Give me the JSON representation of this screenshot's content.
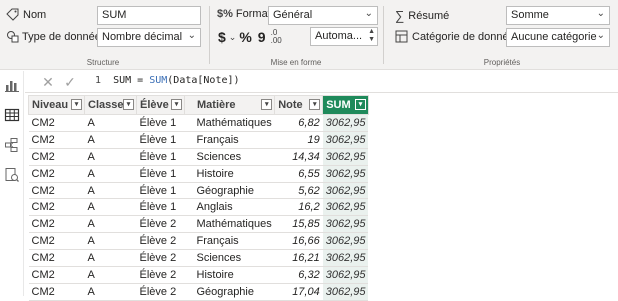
{
  "structure": {
    "name_label": "Nom",
    "name_value": "SUM",
    "datatype_label": "Type de données",
    "datatype_value": "Nombre décimal",
    "group_label": "Structure"
  },
  "formatting": {
    "format_label": "Format",
    "format_value": "Général",
    "currency_symbol": "$",
    "percent_symbol": "%",
    "comma_symbol": "9",
    "decimals_value": "Automa...",
    "group_label": "Mise en forme"
  },
  "properties": {
    "summary_label": "Résumé",
    "summary_value": "Somme",
    "category_label": "Catégorie de données",
    "category_value": "Aucune catégorie",
    "group_label": "Propriétés"
  },
  "formula_bar": {
    "line_number": "1",
    "measure_name": "SUM",
    "equals": "=",
    "function_name": "SUM",
    "argument": "(Data[Note])"
  },
  "table": {
    "columns": [
      "Niveau",
      "Classe",
      "Élève",
      "Matière",
      "Note",
      "SUM"
    ],
    "rows": [
      [
        "CM2",
        "A",
        "Élève 1",
        "Mathématiques",
        "6,82",
        "3062,95"
      ],
      [
        "CM2",
        "A",
        "Élève 1",
        "Français",
        "19",
        "3062,95"
      ],
      [
        "CM2",
        "A",
        "Élève 1",
        "Sciences",
        "14,34",
        "3062,95"
      ],
      [
        "CM2",
        "A",
        "Élève 1",
        "Histoire",
        "6,55",
        "3062,95"
      ],
      [
        "CM2",
        "A",
        "Élève 1",
        "Géographie",
        "5,62",
        "3062,95"
      ],
      [
        "CM2",
        "A",
        "Élève 1",
        "Anglais",
        "16,2",
        "3062,95"
      ],
      [
        "CM2",
        "A",
        "Élève 2",
        "Mathématiques",
        "15,85",
        "3062,95"
      ],
      [
        "CM2",
        "A",
        "Élève 2",
        "Français",
        "16,66",
        "3062,95"
      ],
      [
        "CM2",
        "A",
        "Élève 2",
        "Sciences",
        "16,21",
        "3062,95"
      ],
      [
        "CM2",
        "A",
        "Élève 2",
        "Histoire",
        "6,32",
        "3062,95"
      ],
      [
        "CM2",
        "A",
        "Élève 2",
        "Géographie",
        "17,04",
        "3062,95"
      ]
    ]
  },
  "colors": {
    "sum_header": "#1f8a5b",
    "formula_function": "#3b6fb6"
  }
}
